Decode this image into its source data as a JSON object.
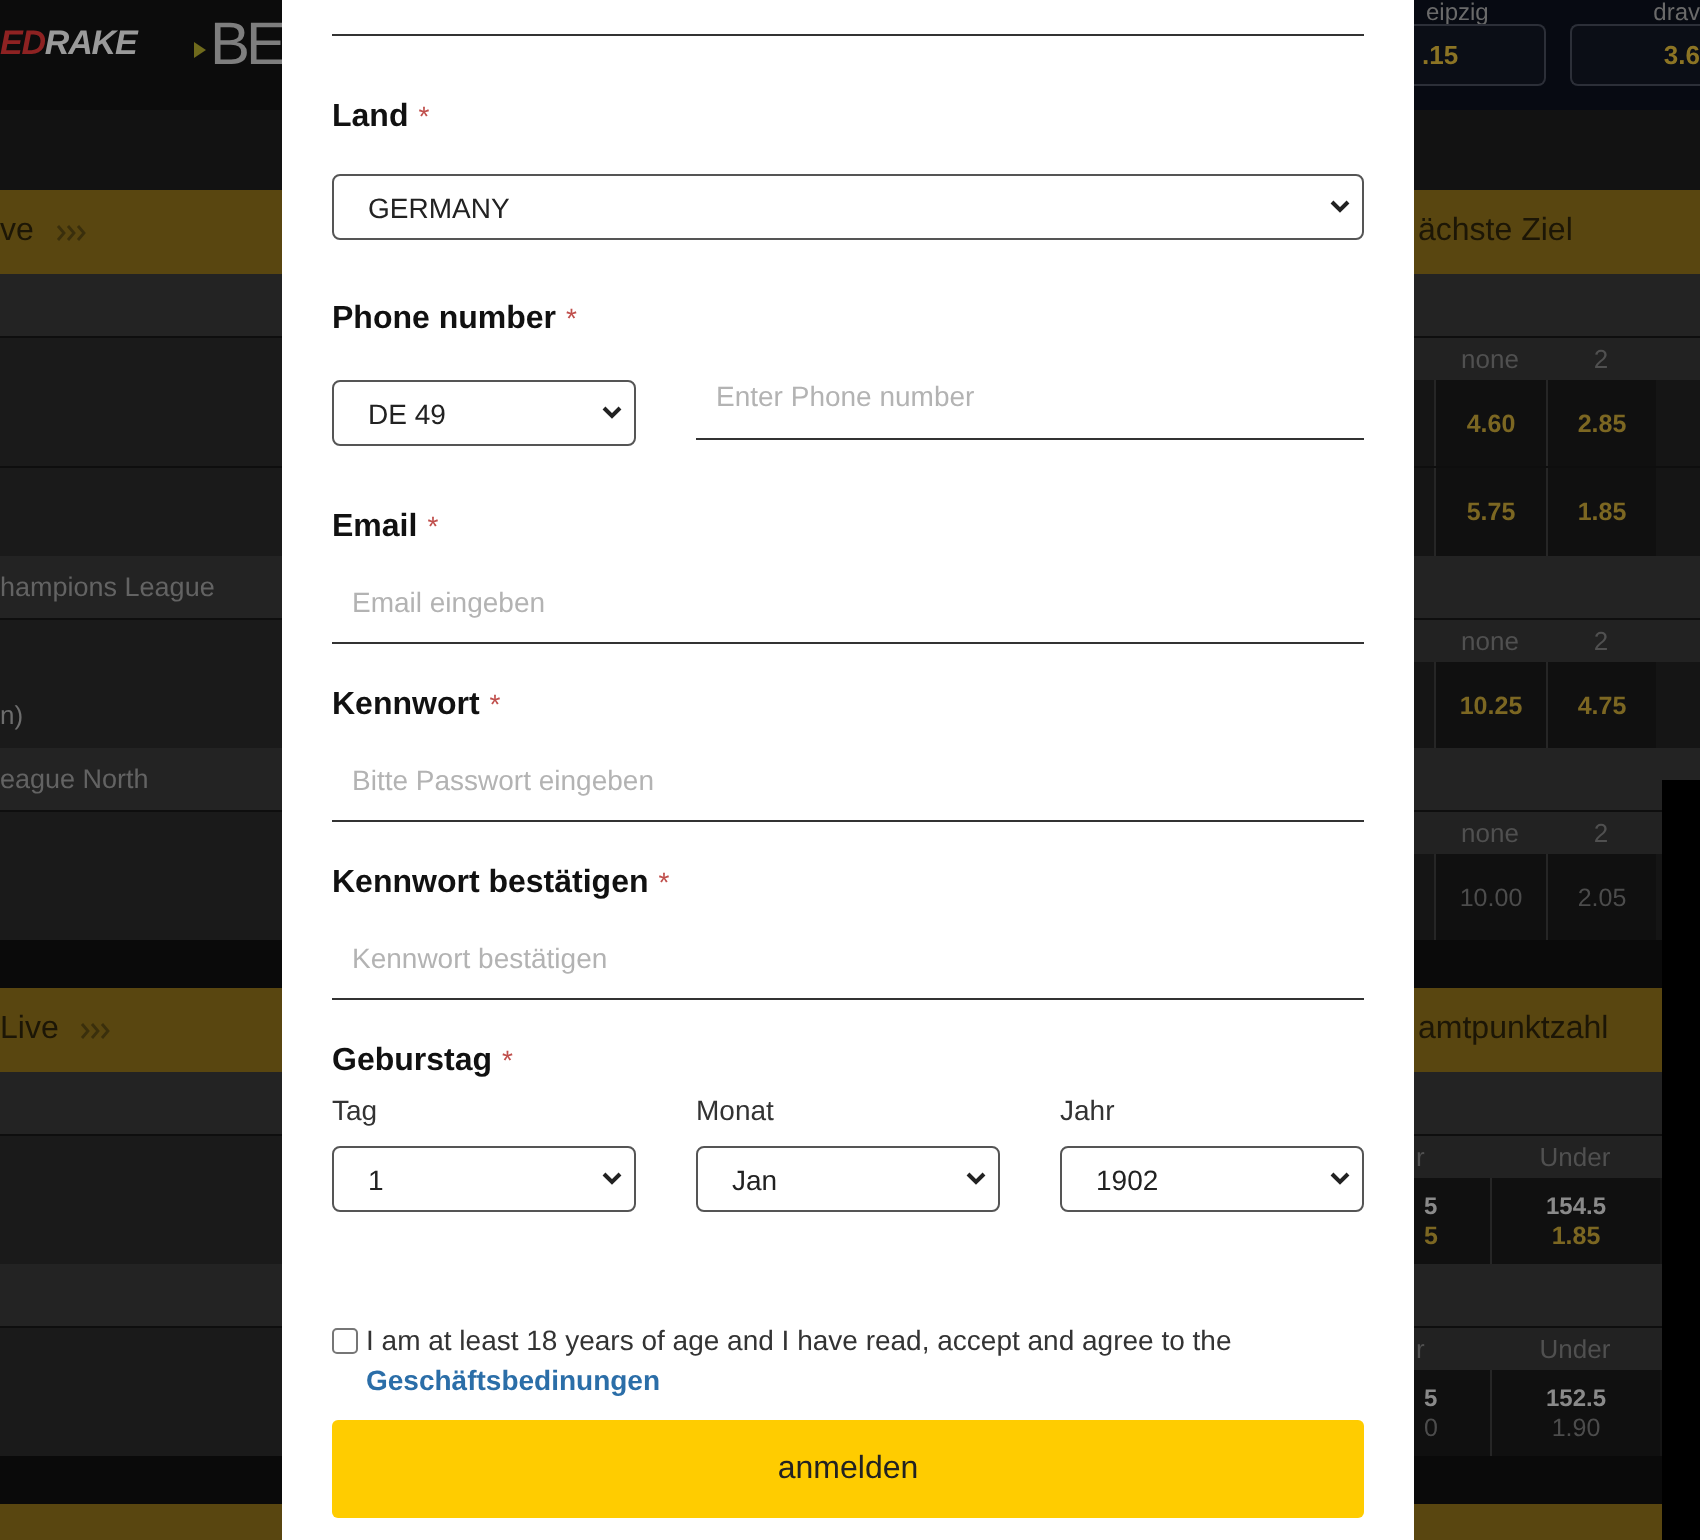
{
  "background": {
    "bands": [
      {
        "kind": "header",
        "logo": {
          "accent": "ED",
          "rest": "RAKE"
        },
        "banner": "BE",
        "teams": [
          "eipzig",
          "drav"
        ],
        "odds": [
          ".15",
          "3.6"
        ]
      },
      {
        "kind": "spacer"
      },
      {
        "kind": "section",
        "left": "ve",
        "right": "ächste Ziel"
      },
      {
        "kind": "group"
      },
      {
        "kind": "odds",
        "columns": [
          "none",
          "2"
        ],
        "cells": [
          {
            "price": "4.60"
          },
          {
            "price": "2.85"
          }
        ],
        "suspended": false
      },
      {
        "kind": "odds",
        "cells": [
          {
            "price": "5.75"
          },
          {
            "price": "1.85"
          }
        ],
        "suspended": false
      },
      {
        "kind": "group",
        "left": "hampions League"
      },
      {
        "kind": "odds",
        "left": "n)",
        "columns": [
          "none",
          "2"
        ],
        "cells": [
          {
            "price": "10.25"
          },
          {
            "price": "4.75"
          }
        ],
        "suspended": false
      },
      {
        "kind": "group",
        "left": "eague North"
      },
      {
        "kind": "odds",
        "columns": [
          "none",
          "2"
        ],
        "cells": [
          {
            "price": "10.00"
          },
          {
            "price": "2.05"
          }
        ],
        "suspended": true
      },
      {
        "kind": "gap"
      },
      {
        "kind": "section",
        "left": "Live",
        "right": "amtpunktzahl"
      },
      {
        "kind": "group"
      },
      {
        "kind": "totals",
        "columns": [
          "r",
          "Under"
        ],
        "cells": [
          {
            "line": "5",
            "price": "5"
          },
          {
            "line": "154.5",
            "price": "1.85"
          }
        ],
        "suspended": false
      },
      {
        "kind": "group"
      },
      {
        "kind": "totals",
        "columns": [
          "r",
          "Under"
        ],
        "cells": [
          {
            "line": "5",
            "price": "0"
          },
          {
            "line": "152.5",
            "price": "1.90"
          }
        ],
        "suspended": true
      },
      {
        "kind": "gap"
      },
      {
        "kind": "section"
      }
    ]
  },
  "form": {
    "groups": [
      {
        "kind": "input"
      },
      {
        "kind": "select",
        "label": "Land",
        "mark": "*",
        "value": "GERMANY"
      },
      {
        "kind": "phone",
        "label": "Phone number",
        "mark": "*",
        "code": "DE 49",
        "placeholder": "Enter Phone number"
      },
      {
        "kind": "input",
        "label": "Email",
        "mark": "*",
        "placeholder": "Email eingeben"
      },
      {
        "kind": "input",
        "label": "Kennwort",
        "mark": "*",
        "placeholder": "Bitte Passwort eingeben"
      },
      {
        "kind": "input",
        "label": "Kennwort bestätigen",
        "mark": "*",
        "placeholder": "Kennwort bestätigen"
      },
      {
        "kind": "date",
        "label": "Geburstag",
        "mark": "*",
        "parts": [
          {
            "label": "Tag",
            "value": "1"
          },
          {
            "label": "Monat",
            "value": "Jan"
          },
          {
            "label": "Jahr",
            "value": "1902"
          }
        ]
      }
    ],
    "terms": {
      "checked": false,
      "text": "I am at least 18 years of age and I have read, accept and agree to the",
      "link": "Geschäftsbedinungen"
    },
    "submit": "anmelden"
  }
}
